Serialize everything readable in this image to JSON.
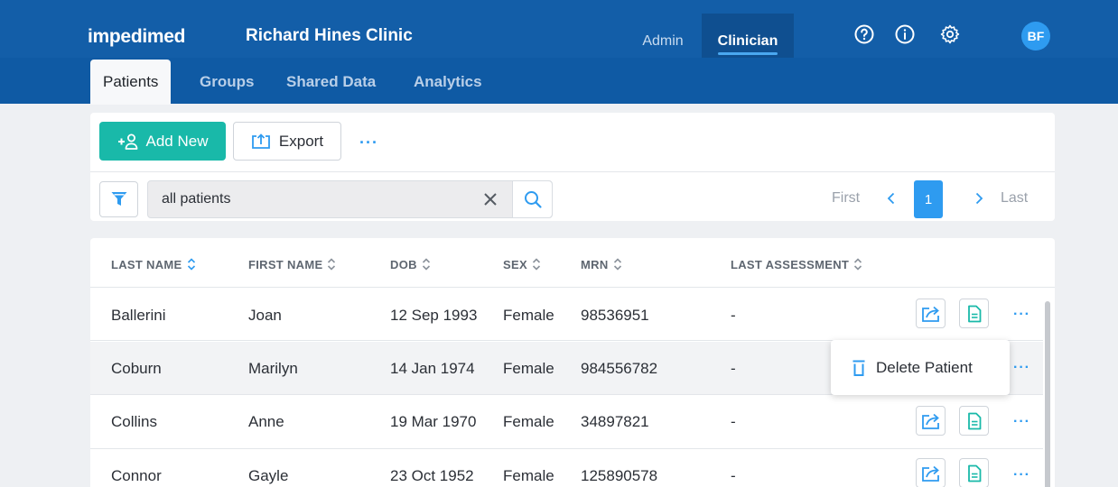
{
  "header": {
    "brand": "impedimed",
    "clinic": "Richard Hines Clinic",
    "roles": [
      "Admin",
      "Clinician"
    ],
    "active_role": "Clinician",
    "avatar_initials": "BF",
    "icons": [
      "help-icon",
      "info-icon",
      "settings-icon"
    ]
  },
  "nav": {
    "tabs": [
      {
        "label": "Patients",
        "active": true
      },
      {
        "label": "Groups",
        "active": false
      },
      {
        "label": "Shared Data",
        "active": false
      },
      {
        "label": "Analytics",
        "active": false
      }
    ]
  },
  "toolbar": {
    "add_label": "Add New",
    "export_label": "Export",
    "more_label": "···"
  },
  "search": {
    "value": "all patients"
  },
  "pagination": {
    "first": "First",
    "current": "1",
    "last": "Last"
  },
  "table": {
    "columns": [
      "LAST NAME",
      "FIRST NAME",
      "DOB",
      "SEX",
      "MRN",
      "LAST ASSESSMENT"
    ],
    "rows": [
      {
        "last": "Ballerini",
        "first": "Joan",
        "dob": "12 Sep 1993",
        "sex": "Female",
        "mrn": "98536951",
        "assessment": "-"
      },
      {
        "last": "Coburn",
        "first": "Marilyn",
        "dob": "14 Jan 1974",
        "sex": "Female",
        "mrn": "984556782",
        "assessment": "-"
      },
      {
        "last": "Collins",
        "first": "Anne",
        "dob": "19 Mar 1970",
        "sex": "Female",
        "mrn": "34897821",
        "assessment": "-"
      },
      {
        "last": "Connor",
        "first": "Gayle",
        "dob": "23 Oct 1952",
        "sex": "Female",
        "mrn": "125890578",
        "assessment": "-"
      }
    ],
    "row_more": "···"
  },
  "popup": {
    "delete_label": "Delete Patient"
  },
  "colors": {
    "header_bg": "#135ea8",
    "accent_teal": "#19b9a9",
    "accent_blue": "#2e9bf0"
  }
}
